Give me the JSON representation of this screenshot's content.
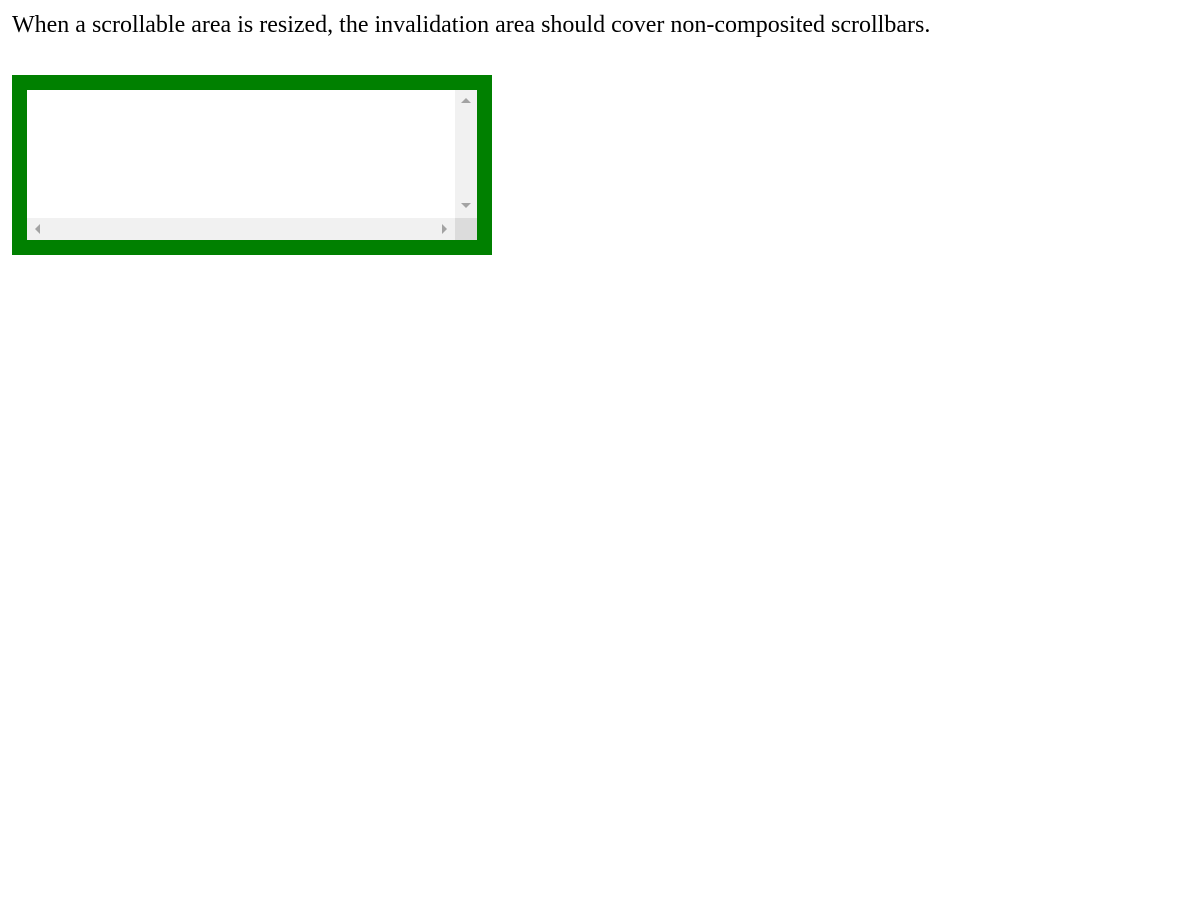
{
  "description": "When a scrollable area is resized, the invalidation area should cover non-composited scrollbars.",
  "colors": {
    "frame_border": "#008000",
    "scrollbar_track": "#f1f1f1",
    "scrollbar_arrow": "#a3a3a3",
    "scrollbar_corner": "#dcdcdc"
  },
  "scroll_area": {
    "icons": {
      "scroll_up": "triangle-up-icon",
      "scroll_down": "triangle-down-icon",
      "scroll_left": "triangle-left-icon",
      "scroll_right": "triangle-right-icon"
    }
  }
}
